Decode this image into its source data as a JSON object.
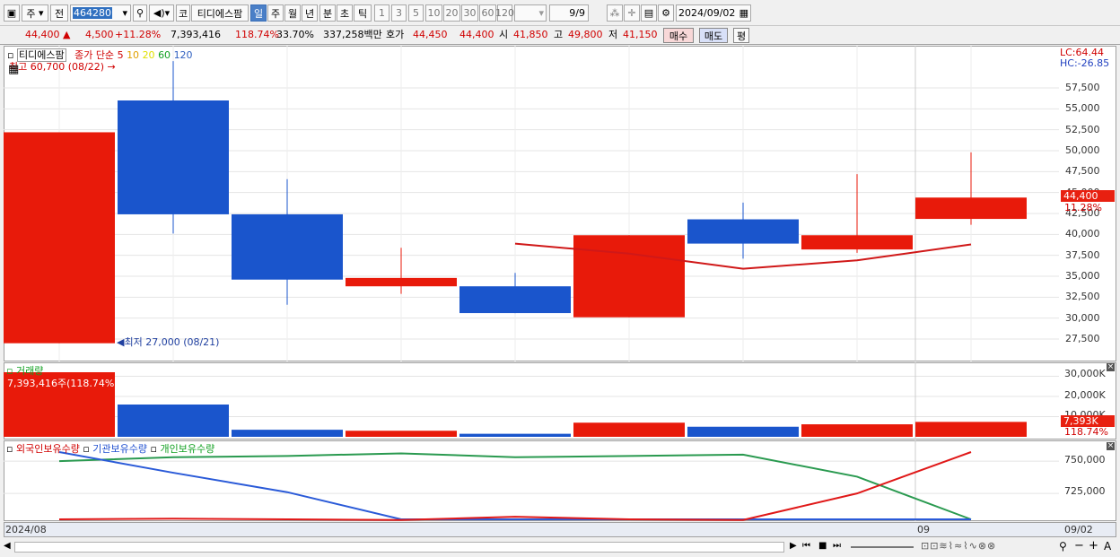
{
  "toolbar": {
    "market_sel": "주",
    "prev_label": "전",
    "code": "464280",
    "code_tag": "코",
    "stock_name": "티디에스팜",
    "periods": [
      "일",
      "주",
      "월",
      "년",
      "분",
      "초",
      "틱"
    ],
    "minutes": [
      "1",
      "3",
      "5",
      "10",
      "20",
      "30",
      "60",
      "120"
    ],
    "page": "9/9",
    "date": "2024/09/02"
  },
  "quote": {
    "price": "44,400",
    "change": "4,500",
    "rate": "+11.28%",
    "volume": "7,393,416",
    "vol_ratio": "118.74%",
    "turnover": "33.70%",
    "amount": "337,258백만",
    "hoga_label": "호가",
    "ask": "44,450",
    "bid": "44,400",
    "open_label": "시",
    "open": "41,850",
    "high_label": "고",
    "high": "49,800",
    "low_label": "저",
    "low": "41,150",
    "buy": "매수",
    "sell": "매도",
    "eval": "평"
  },
  "price_panel": {
    "name": "티디에스팜",
    "ma_label": "종가 단순",
    "ma_periods": [
      {
        "p": "5",
        "color": "#d00000"
      },
      {
        "p": "10",
        "color": "#e0a000"
      },
      {
        "p": "20",
        "color": "#e0e000"
      },
      {
        "p": "60",
        "color": "#10a020"
      },
      {
        "p": "120",
        "color": "#3060c0"
      }
    ],
    "high_note": "최고 60,700 (08/22)",
    "low_note": "최저 27,000 (08/21)",
    "lc": "LC:64.44",
    "hc": "HC:-26.85",
    "yticks": [
      "57,500",
      "55,000",
      "52,500",
      "50,000",
      "47,500",
      "45,000",
      "42,500",
      "40,000",
      "37,500",
      "35,000",
      "32,500",
      "30,000",
      "27,500"
    ],
    "last_price": "44,400",
    "last_rate": "11.28%"
  },
  "volume_panel": {
    "title": "거래량",
    "note": "7,393,416주(118.74%)",
    "yticks": [
      "30,000K",
      "20,000K",
      "10,000K"
    ],
    "last": "7,393K",
    "last_rate": "118.74%"
  },
  "holding_panel": {
    "legend": [
      "외국인보유수량",
      "기관보유수량",
      "개인보유수량"
    ],
    "yticks": [
      "750,000",
      "725,000"
    ]
  },
  "xaxis": {
    "left": "2024/08",
    "mid": "09",
    "right": "09/02"
  },
  "chart_data": {
    "type": "candlestick",
    "candles": [
      {
        "o": 27000,
        "h": 52200,
        "l": 27000,
        "c": 52200,
        "color": "red"
      },
      {
        "o": 56000,
        "h": 60700,
        "l": 40100,
        "c": 42400,
        "color": "blue"
      },
      {
        "o": 42400,
        "h": 46600,
        "l": 31600,
        "c": 34600,
        "color": "blue"
      },
      {
        "o": 33800,
        "h": 38400,
        "l": 32900,
        "c": 34800,
        "color": "red"
      },
      {
        "o": 33800,
        "h": 35400,
        "l": 30600,
        "c": 30600,
        "color": "blue"
      },
      {
        "o": 30100,
        "h": 39900,
        "l": 30100,
        "c": 39900,
        "color": "red"
      },
      {
        "o": 41800,
        "h": 43800,
        "l": 37100,
        "c": 38900,
        "color": "blue"
      },
      {
        "o": 38200,
        "h": 47200,
        "l": 37800,
        "c": 39900,
        "color": "red"
      },
      {
        "o": 41850,
        "h": 49800,
        "l": 41150,
        "c": 44400,
        "color": "red"
      }
    ],
    "ma5": [
      null,
      null,
      null,
      null,
      38900,
      37700,
      35900,
      36900,
      38800
    ],
    "volume": [
      {
        "v": 32000,
        "color": "red"
      },
      {
        "v": 16000,
        "color": "blue"
      },
      {
        "v": 3500,
        "color": "blue"
      },
      {
        "v": 3000,
        "color": "red"
      },
      {
        "v": 1500,
        "color": "blue"
      },
      {
        "v": 7000,
        "color": "red"
      },
      {
        "v": 5000,
        "color": "blue"
      },
      {
        "v": 6200,
        "color": "red"
      },
      {
        "v": 7393,
        "color": "red"
      }
    ],
    "holdings": {
      "foreign": [
        705000,
        705500,
        705000,
        704500,
        707000,
        705000,
        704500,
        725000,
        757000
      ],
      "institution": [
        757000,
        741000,
        726000,
        705000,
        705000,
        705000,
        705000,
        705000,
        705000
      ],
      "individual": [
        750000,
        753000,
        754000,
        756000,
        753000,
        754000,
        755000,
        738000,
        705000
      ]
    }
  }
}
